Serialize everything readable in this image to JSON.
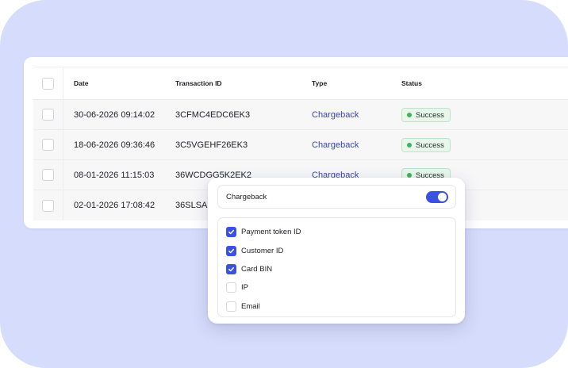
{
  "table": {
    "headers": {
      "date": "Date",
      "transaction_id": "Transaction ID",
      "type": "Type",
      "status": "Status"
    },
    "rows": [
      {
        "date": "30-06-2026 09:14:02",
        "transaction_id": "3CFMC4EDC6EK3",
        "type": "Chargeback",
        "status": "Success"
      },
      {
        "date": "18-06-2026 09:36:46",
        "transaction_id": "3C5VGEHF26EK3",
        "type": "Chargeback",
        "status": "Success"
      },
      {
        "date": "08-01-2026 11:15:03",
        "transaction_id": "36WCDGG5K2EK2",
        "type": "Chargeback",
        "status": "Success"
      },
      {
        "date": "02-01-2026 17:08:42",
        "transaction_id": "36SLSA",
        "type": "",
        "status": ""
      }
    ]
  },
  "popup": {
    "title": "Chargeback",
    "toggle_on": true,
    "options": [
      {
        "label": "Payment token ID",
        "checked": true
      },
      {
        "label": "Customer ID",
        "checked": true
      },
      {
        "label": "Card BIN",
        "checked": true
      },
      {
        "label": "IP",
        "checked": false
      },
      {
        "label": "Email",
        "checked": false
      }
    ]
  },
  "colors": {
    "backdrop": "#d6dcfb",
    "accent": "#3b52e0",
    "link": "#3a45a8",
    "success_dot": "#3fb35a"
  }
}
